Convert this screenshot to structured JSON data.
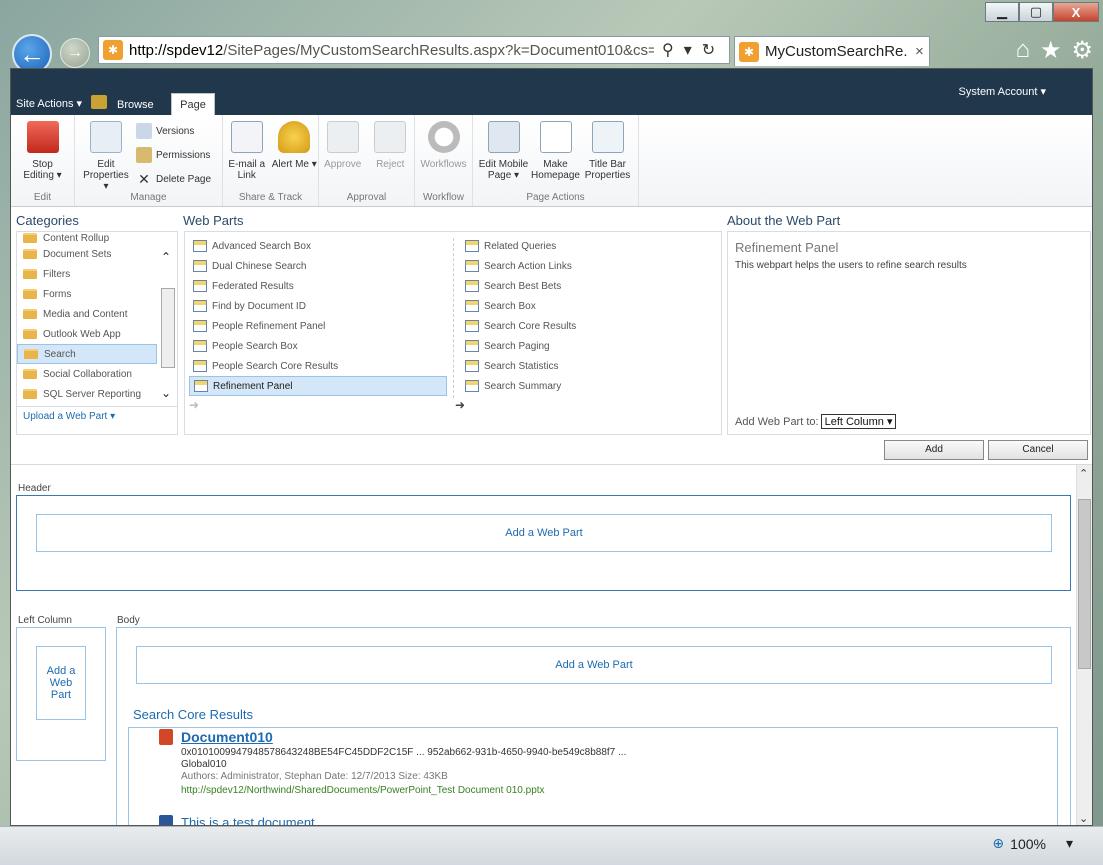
{
  "window": {
    "minimize": "▁",
    "maximize": "▢",
    "close": "X"
  },
  "browser": {
    "url_prefix": "http://spdev12",
    "url_rest": "/SitePages/MyCustomSearchResults.aspx?k=Document010&cs=",
    "tab_title": "MyCustomSearchRe...",
    "tab_close": "×",
    "zoom": "100%"
  },
  "topbar": {
    "site_actions": "Site Actions ▾",
    "browse": "Browse",
    "page": "Page",
    "system_account": "System Account ▾"
  },
  "ribbon": {
    "groups": [
      {
        "label": "Edit",
        "buttons": [
          {
            "label": "Stop Editing ▾"
          }
        ]
      },
      {
        "label": "Manage",
        "buttons": [
          {
            "label": "Edit Properties ▾"
          }
        ],
        "small": [
          "Versions",
          "Permissions",
          "Delete Page"
        ]
      },
      {
        "label": "Share & Track",
        "buttons": [
          {
            "label": "E-mail a Link"
          },
          {
            "label": "Alert Me ▾"
          }
        ]
      },
      {
        "label": "Approval",
        "buttons": [
          {
            "label": "Approve"
          },
          {
            "label": "Reject"
          }
        ]
      },
      {
        "label": "Workflow",
        "buttons": [
          {
            "label": "Workflows"
          }
        ]
      },
      {
        "label": "Page Actions",
        "buttons": [
          {
            "label": "Edit Mobile Page ▾"
          },
          {
            "label": "Make Homepage"
          },
          {
            "label": "Title Bar Properties"
          }
        ]
      }
    ]
  },
  "adder": {
    "categories_title": "Categories",
    "categories": [
      "Content Rollup",
      "Document Sets",
      "Filters",
      "Forms",
      "Media and Content",
      "Outlook Web App",
      "Search",
      "Social Collaboration",
      "SQL Server Reporting"
    ],
    "selected_category": "Search",
    "upload": "Upload a Web Part ▾",
    "webparts_title": "Web Parts",
    "webparts_left": [
      "Advanced Search Box",
      "Dual Chinese Search",
      "Federated Results",
      "Find by Document ID",
      "People Refinement Panel",
      "People Search Box",
      "People Search Core Results",
      "Refinement Panel"
    ],
    "webparts_right": [
      "Related Queries",
      "Search Action Links",
      "Search Best Bets",
      "Search Box",
      "Search Core Results",
      "Search Paging",
      "Search Statistics",
      "Search Summary"
    ],
    "selected_webpart": "Refinement Panel",
    "about_title": "About the Web Part",
    "about_name": "Refinement Panel",
    "about_desc": "This webpart helps the users to refine search results",
    "add_to_label": "Add Web Part to:",
    "add_to_value": "Left Column",
    "add_button": "Add",
    "cancel_button": "Cancel"
  },
  "content": {
    "header_label": "Header",
    "add_web_part": "Add a Web Part",
    "left_column_label": "Left Column",
    "left_add": "Add a Web Part",
    "body_label": "Body",
    "search_core_title": "Search Core Results",
    "result": {
      "title": "Document010",
      "line1": "0x0101009947948578643248BE54FC45DDF2C15F ... 952ab662-931b-4650-9940-be549c8b88f7 ...",
      "line2": "Global010",
      "meta": "Authors: Administrator, Stephan   Date: 12/7/2013   Size: 43KB",
      "url": "http://spdev12/Northwind/SharedDocuments/PowerPoint_Test Document 010.pptx"
    },
    "next_result": "This is a test document"
  }
}
